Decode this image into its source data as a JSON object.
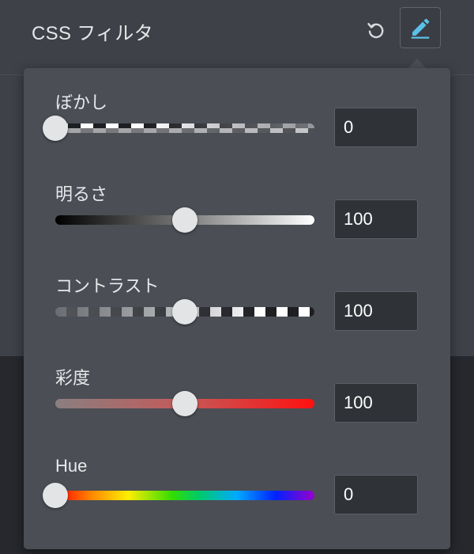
{
  "header": {
    "title": "CSS フィルタ",
    "reset_icon": "reset-icon",
    "edit_icon": "pencil-icon",
    "accent_color": "#5bc0e8"
  },
  "filters": [
    {
      "label": "ぼかし",
      "value": "0",
      "level": 0
    },
    {
      "label": "明るさ",
      "value": "100",
      "level": 0.5
    },
    {
      "label": "コントラスト",
      "value": "100",
      "level": 0.5
    },
    {
      "label": "彩度",
      "value": "100",
      "level": 0.5
    },
    {
      "label": "Hue",
      "value": "0",
      "level": 0
    }
  ]
}
